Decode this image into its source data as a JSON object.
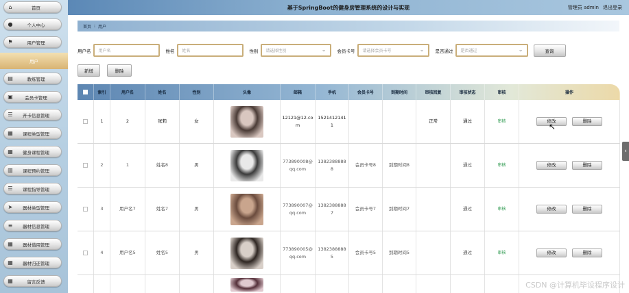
{
  "app": {
    "title": "基于SpringBoot的健身房管理系统的设计与实现",
    "user": "管理员 admin",
    "logout": "退出登录"
  },
  "sidebar": {
    "active": "用户",
    "items": [
      {
        "label": "首页",
        "icon": "home-icon",
        "glyph": "⌂"
      },
      {
        "label": "个人中心",
        "icon": "person-icon",
        "glyph": "●"
      },
      {
        "label": "用户管理",
        "icon": "flag-icon",
        "glyph": "⚑"
      },
      {
        "label": "教练管理",
        "icon": "card-icon",
        "glyph": "▤"
      },
      {
        "label": "会员卡管理",
        "icon": "briefcase-icon",
        "glyph": "▣"
      },
      {
        "label": "开卡信息管理",
        "icon": "list-icon",
        "glyph": "☰"
      },
      {
        "label": "课程类型管理",
        "icon": "grid-icon",
        "glyph": "▦"
      },
      {
        "label": "健身课程管理",
        "icon": "grid-icon",
        "glyph": "▦"
      },
      {
        "label": "课程预约管理",
        "icon": "calendar-icon",
        "glyph": "▥"
      },
      {
        "label": "课程指导管理",
        "icon": "list-icon",
        "glyph": "☰"
      },
      {
        "label": "器材类型管理",
        "icon": "send-icon",
        "glyph": "➤"
      },
      {
        "label": "器材信息管理",
        "icon": "sliders-icon",
        "glyph": "≡"
      },
      {
        "label": "器材借用管理",
        "icon": "grid-icon",
        "glyph": "▦"
      },
      {
        "label": "器材归还管理",
        "icon": "grid-icon",
        "glyph": "▦"
      },
      {
        "label": "留言反馈",
        "icon": "grid-icon",
        "glyph": "▦"
      }
    ]
  },
  "breadcrumb": {
    "home": "首页",
    "separator": "⁝",
    "current": "用户"
  },
  "search": {
    "username_label": "用户名",
    "username_placeholder": "用户名",
    "name_label": "姓名",
    "name_placeholder": "姓名",
    "gender_label": "性别",
    "gender_placeholder": "请选择性别",
    "card_label": "会员卡号",
    "card_placeholder": "请选择会员卡号",
    "approved_label": "是否通过",
    "approved_placeholder": "是否通过",
    "query_button": "查询"
  },
  "actions": {
    "add": "新增",
    "delete": "删除"
  },
  "table": {
    "headers": [
      "",
      "索引",
      "用户名",
      "姓名",
      "性别",
      "头像",
      "邮箱",
      "手机",
      "会员卡号",
      "到期时间",
      "审核回复",
      "审核状态",
      "审核",
      "操作"
    ],
    "rows": [
      {
        "index": "1",
        "username": "2",
        "name": "张莉",
        "gender": "女",
        "avatar_colors": [
          "#d9c7c0",
          "#4a3b36"
        ],
        "email": "12121@12.com",
        "phone": "15214121411",
        "card": "",
        "expire": "",
        "reply": "正常",
        "status": "通过",
        "audit": "审核",
        "edit": "修改",
        "remove": "删除",
        "dark": true
      },
      {
        "index": "2",
        "username": "1",
        "name": "姓名8",
        "gender": "男",
        "avatar_colors": [
          "#e9e9e9",
          "#3b3b3b"
        ],
        "email": "773890008@qq.com",
        "phone": "13823888888",
        "card": "会员卡号8",
        "expire": "到期时间8",
        "reply": "",
        "status": "通过",
        "audit": "审核",
        "edit": "修改",
        "remove": "删除",
        "dark": false
      },
      {
        "index": "3",
        "username": "用户名7",
        "name": "姓名7",
        "gender": "男",
        "avatar_colors": [
          "#c9a58d",
          "#6b4c3e"
        ],
        "email": "773890007@qq.com",
        "phone": "13823888887",
        "card": "会员卡号7",
        "expire": "到期时间7",
        "reply": "",
        "status": "通过",
        "audit": "审核",
        "edit": "修改",
        "remove": "删除",
        "dark": false
      },
      {
        "index": "4",
        "username": "用户名5",
        "name": "姓名5",
        "gender": "男",
        "avatar_colors": [
          "#d8cfc8",
          "#2e2622"
        ],
        "email": "773890005@qq.com",
        "phone": "13823888885",
        "card": "会员卡号5",
        "expire": "到期时间5",
        "reply": "",
        "status": "通过",
        "audit": "审核",
        "edit": "修改",
        "remove": "删除",
        "dark": false
      },
      {
        "index": "",
        "username": "",
        "name": "",
        "gender": "",
        "avatar_colors": [
          "#e0c9cf",
          "#55303a"
        ],
        "email": "",
        "phone": "",
        "card": "",
        "expire": "",
        "reply": "",
        "status": "",
        "audit": "",
        "edit": "",
        "remove": "",
        "dark": false
      }
    ]
  },
  "watermark": "CSDN @计算机毕设程序设计"
}
